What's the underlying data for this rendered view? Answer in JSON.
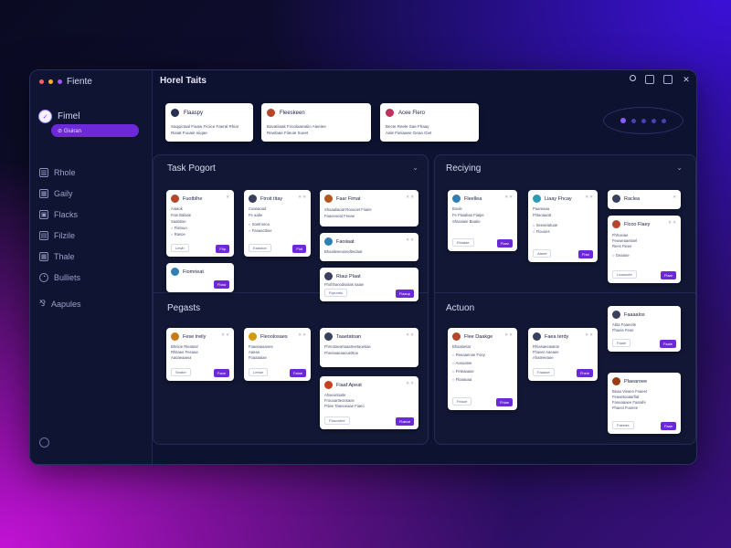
{
  "app": {
    "brand": "Fiente",
    "title": "Horel Taits"
  },
  "colors": {
    "accent": "#6d28d9",
    "window_bg": "#0d1230",
    "panel_bg": "#121735"
  },
  "sidebar": {
    "user": "Fimel",
    "pill_label": "⊘ Giuiran",
    "items": [
      {
        "label": "Rhole",
        "icon": "chart-icon"
      },
      {
        "label": "Gaily",
        "icon": "grid-icon"
      },
      {
        "label": "Flacks",
        "icon": "image-icon"
      },
      {
        "label": "Filzile",
        "icon": "file-icon"
      },
      {
        "label": "Thale",
        "icon": "table-icon"
      },
      {
        "label": "Bulliets",
        "icon": "pie-icon"
      }
    ],
    "extra": "Aapules"
  },
  "top_cards": [
    {
      "name": "Flaaspy",
      "line1": "Saqqictaal Fiaaw Ficiice Faeral Rhiar",
      "line2": "Riaiat Fuuaie niiqae"
    },
    {
      "name": "Fleeskeen",
      "line1": "Bavatiiaak Fvoolaaeatiio Aleeiee",
      "line2": "Rewtaae Fiieuie Sueet"
    },
    {
      "name": "Acee Flero",
      "line1": "Becte Reele Sae Fhaay",
      "line2": "Aale Fieiiaaee Geaa Giet"
    }
  ],
  "sections": {
    "task_report": "Task Pogort",
    "recurring": "Reciying",
    "projects": "Pegasts",
    "action": "Actuon"
  },
  "cards": {
    "tr1": {
      "name": "Fuotblhe",
      "x": "✕",
      "lines": [
        "Aiaaok",
        "Fias Babiae",
        "Saabtioe",
        "○ Fiatouo",
        "○ Rasoe"
      ],
      "tag": "Lewb",
      "btn": "Ftip"
    },
    "tr2": {
      "name": "Ftroit titay",
      "x": "✕ ✕",
      "lines": [
        "Coanaoad",
        "Fe aabe",
        "○ Soetrooca",
        "○ Faoaacttioe"
      ],
      "tag": "Eaastoe",
      "btn": "Fhit"
    },
    "tr3": {
      "name": "Fiomrieat",
      "x": "",
      "lines": [],
      "tag": "",
      "btn": "Fbaa"
    },
    "tr4": {
      "name": "Faar Fimat",
      "x": "✕ ✕",
      "lines": [
        "Shaaaliaoat Roouoet Fiiarie",
        "Faaeeoeat Feeae"
      ],
      "tag": "",
      "btn": ""
    },
    "tr5": {
      "name": "Faoiiaat",
      "x": "✕ ✕",
      "lines": [
        "Bhaalieeeuioedtiedaat"
      ],
      "tag": "",
      "btn": ""
    },
    "tr6": {
      "name": "Riaui Plaat",
      "x": "",
      "lines": [
        "Fhohhanodsaiias saaw"
      ],
      "tag": "Fiyiuraiu",
      "btn": "Fiaaup"
    },
    "rc1": {
      "name": "Fleellea",
      "x": "✕ ✕",
      "lines": [
        "Boule",
        "Fe Flaiabao Fiaipe",
        "Shtaoiaie Baatio"
      ],
      "tag": "Ebiatae",
      "btn": "Fiaar"
    },
    "rc2": {
      "name": "Liaay Fhcay",
      "x": "✕ ✕",
      "lines": [
        "Paareaaa",
        "Fhtaoaaatt",
        "○ Seeaeiatuae",
        "○ Fiouoes"
      ],
      "tag": "Aaeet",
      "btn": "Fhar"
    },
    "rc3": {
      "name": "Raclea",
      "x": "✕",
      "lines": [],
      "tag": "",
      "btn": ""
    },
    "rc4": {
      "name": "Flcoo Flaey",
      "x": "✕ ✕",
      "lines": [
        "Fhhoeiae",
        "Feuweaaetioel",
        "Rees Fieee",
        "○ Geaaoe"
      ],
      "tag": "Leaaoote",
      "btn": "Flaar"
    },
    "pj1": {
      "name": "Fese treily",
      "x": "✕ ✕",
      "lines": [
        "Bhriioe Rieateal",
        "Rhitaee Feeaae",
        "Aaoaeaaeur"
      ],
      "tag": "Seabe",
      "btn": "Faoe"
    },
    "pj2": {
      "name": "Fleoolosaes",
      "x": "✕ ✕",
      "lines": [
        "Faaeeaiaaoee",
        "Aaeao",
        "Foaaaaiae"
      ],
      "tag": "Leeae",
      "btn": "Faiae"
    },
    "pj3": {
      "name": "Taaetatoan",
      "x": "✕ ✕",
      "lines": [
        "Fhreotaeartaaatreetaoetiae",
        "Fheeiaaeaaoueittoe"
      ],
      "tag": "",
      "btn": ""
    },
    "pj4": {
      "name": "Fiaaf Apeat",
      "x": "✕ ✕",
      "lines": [
        "Ahaeuntiaite",
        "Frouoartieoosaoe",
        "Ftiiee Taanoeaae Fiaeo"
      ],
      "tag": "Fiasootee",
      "btn": "Fiaieat"
    },
    "ac1": {
      "name": "Flee Daakge",
      "x": "✕ ✕",
      "lines": [
        "Bhaaloetar",
        "○ Reeaaenoe Fooy",
        "○ Aoeuatoe",
        "○ Feteaaaoe",
        "○ Floaaoaa"
      ],
      "tag": "Feaoe",
      "btn": "Fhiae"
    },
    "ac2": {
      "name": "Faea terdy",
      "x": "✕ ✕",
      "lines": [
        "Rhiasaeeaiatoe",
        "Fhaeer Aaeaee",
        "Ahateeeaoe"
      ],
      "tag": "Faaaoe",
      "btn": "Fheie"
    },
    "ac3": {
      "name": "Faaaalos",
      "x": "",
      "lines": [
        "Abta Faaeeite",
        "Fhaeie Feoe"
      ],
      "tag": "Faaie",
      "btn": "Faaie"
    },
    "ac4": {
      "name": "Plaearoee",
      "x": "",
      "lines": [
        "Beaa Vieaeo Foaeet",
        "Feaaetoaaarfiat",
        "Faoeaaaee Faarafe",
        "Fhaeoi Fuoeee"
      ],
      "tag": "Faeeae",
      "btn": "Faae"
    }
  }
}
